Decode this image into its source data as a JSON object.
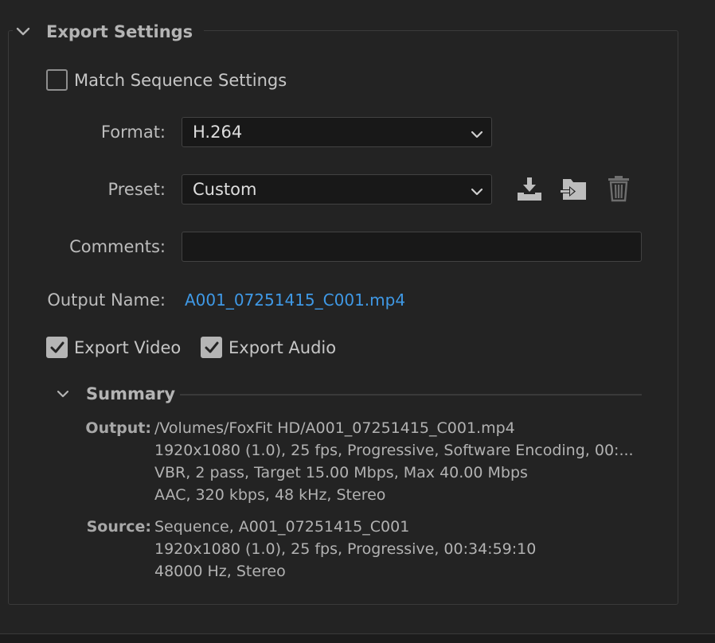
{
  "export_settings": {
    "title": "Export Settings",
    "match_sequence": {
      "label": "Match Sequence Settings",
      "checked": false
    },
    "format": {
      "label": "Format:",
      "value": "H.264"
    },
    "preset": {
      "label": "Preset:",
      "value": "Custom",
      "actions": [
        "save-preset-icon",
        "import-preset-icon",
        "delete-preset-icon"
      ]
    },
    "comments": {
      "label": "Comments:",
      "value": "",
      "placeholder": ""
    },
    "output_name": {
      "label": "Output Name:",
      "value": "A001_07251415_C001.mp4"
    },
    "export_video": {
      "label": "Export Video",
      "checked": true
    },
    "export_audio": {
      "label": "Export Audio",
      "checked": true
    }
  },
  "summary": {
    "title": "Summary",
    "output": {
      "label": "Output:",
      "lines": [
        "/Volumes/FoxFit HD/A001_07251415_C001.mp4",
        "1920x1080 (1.0), 25 fps, Progressive, Software Encoding, 00:...",
        "VBR, 2 pass, Target 15.00 Mbps, Max 40.00 Mbps",
        "AAC, 320 kbps, 48 kHz, Stereo"
      ]
    },
    "source": {
      "label": "Source:",
      "lines": [
        "Sequence, A001_07251415_C001",
        "1920x1080 (1.0), 25 fps, Progressive, 00:34:59:10",
        "48000 Hz, Stereo"
      ]
    }
  },
  "colors": {
    "background": "#232323",
    "field_bg": "#181818",
    "link": "#3f99e6",
    "text": "#c9c9c9"
  }
}
